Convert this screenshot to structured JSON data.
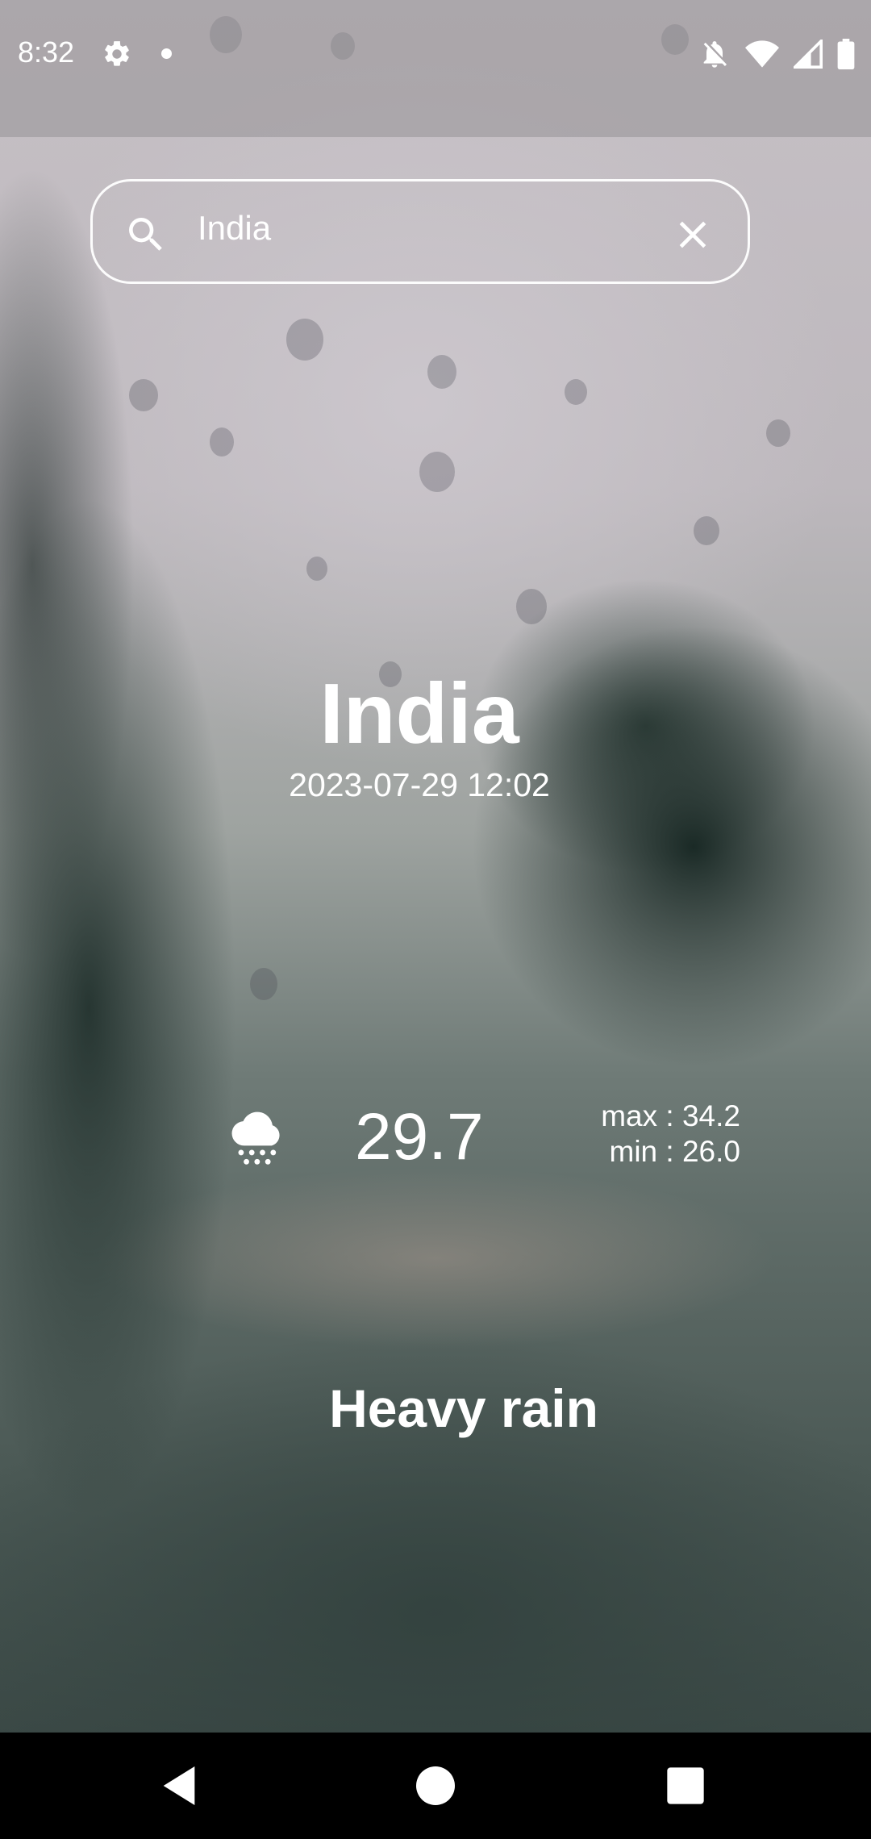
{
  "status_bar": {
    "time": "8:32",
    "icons": [
      "settings-icon",
      "notification-dot",
      "bell-off-icon",
      "wifi-icon",
      "signal-icon",
      "battery-icon"
    ]
  },
  "search": {
    "value": "India",
    "placeholder": "",
    "icon": "search-icon",
    "clear_icon": "close-icon"
  },
  "location": {
    "name": "India",
    "datetime": "2023-07-29 12:02"
  },
  "weather": {
    "icon": "rain-cloud-icon",
    "temperature": "29.7",
    "max": "max : 34.2",
    "min": "min : 26.0",
    "condition": "Heavy rain"
  },
  "nav_bar": {
    "icons": [
      "back-icon",
      "home-icon",
      "recents-icon"
    ]
  },
  "colors": {
    "text": "#ffffff",
    "nav_background": "#000000"
  }
}
